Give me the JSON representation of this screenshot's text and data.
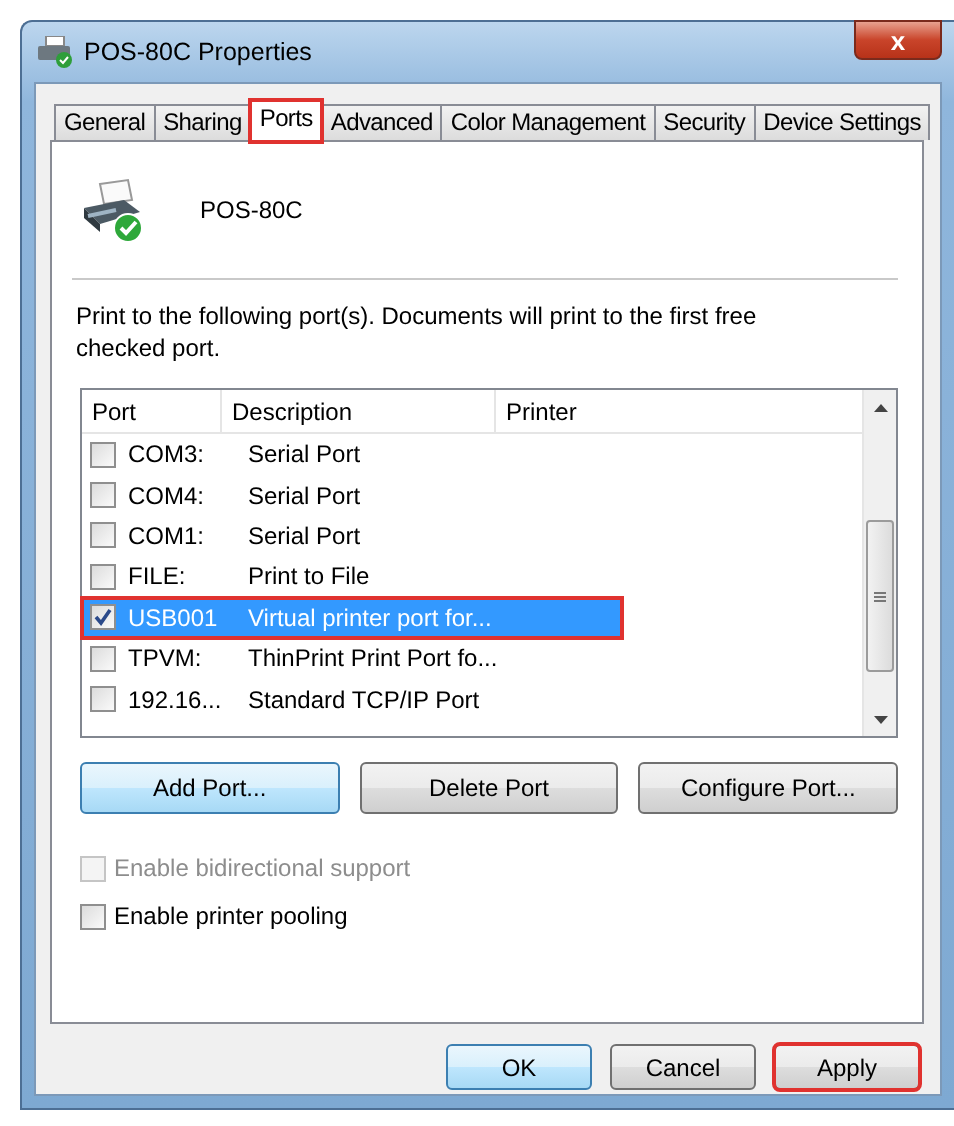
{
  "window": {
    "title": "POS-80C Properties",
    "close": "x"
  },
  "tabs": [
    {
      "label": "General",
      "selected": false,
      "highlighted": false
    },
    {
      "label": "Sharing",
      "selected": false,
      "highlighted": false
    },
    {
      "label": "Ports",
      "selected": true,
      "highlighted": true
    },
    {
      "label": "Advanced",
      "selected": false,
      "highlighted": false
    },
    {
      "label": "Color Management",
      "selected": false,
      "highlighted": false
    },
    {
      "label": "Security",
      "selected": false,
      "highlighted": false
    },
    {
      "label": "Device Settings",
      "selected": false,
      "highlighted": false
    }
  ],
  "printer_name": "POS-80C",
  "instructions": "Print to the following port(s). Documents will print to the first free checked port.",
  "port_list": {
    "columns": [
      "Port",
      "Description",
      "Printer"
    ],
    "rows": [
      {
        "port": "COM3:",
        "description": "Serial Port",
        "checked": false,
        "selected": false,
        "highlighted": false
      },
      {
        "port": "COM4:",
        "description": "Serial Port",
        "checked": false,
        "selected": false,
        "highlighted": false
      },
      {
        "port": "COM1:",
        "description": "Serial Port",
        "checked": false,
        "selected": false,
        "highlighted": false
      },
      {
        "port": "FILE:",
        "description": "Print to File",
        "checked": false,
        "selected": false,
        "highlighted": false
      },
      {
        "port": "USB001",
        "description": "Virtual printer port for...",
        "checked": true,
        "selected": true,
        "highlighted": true
      },
      {
        "port": "TPVM:",
        "description": "ThinPrint Print Port fo...",
        "checked": false,
        "selected": false,
        "highlighted": false
      },
      {
        "port": "192.16...",
        "description": "Standard TCP/IP Port",
        "checked": false,
        "selected": false,
        "highlighted": false
      }
    ]
  },
  "port_buttons": [
    {
      "label": "Add Port...",
      "focused": true
    },
    {
      "label": "Delete Port",
      "focused": false
    },
    {
      "label": "Configure Port...",
      "focused": false
    }
  ],
  "options": [
    {
      "label": "Enable bidirectional support",
      "checked": false,
      "disabled": true
    },
    {
      "label": "Enable printer pooling",
      "checked": false,
      "disabled": false
    }
  ],
  "dialog_buttons": [
    {
      "label": "OK",
      "focused": true,
      "highlighted": false
    },
    {
      "label": "Cancel",
      "focused": false,
      "highlighted": false
    },
    {
      "label": "Apply",
      "focused": false,
      "highlighted": true
    }
  ]
}
